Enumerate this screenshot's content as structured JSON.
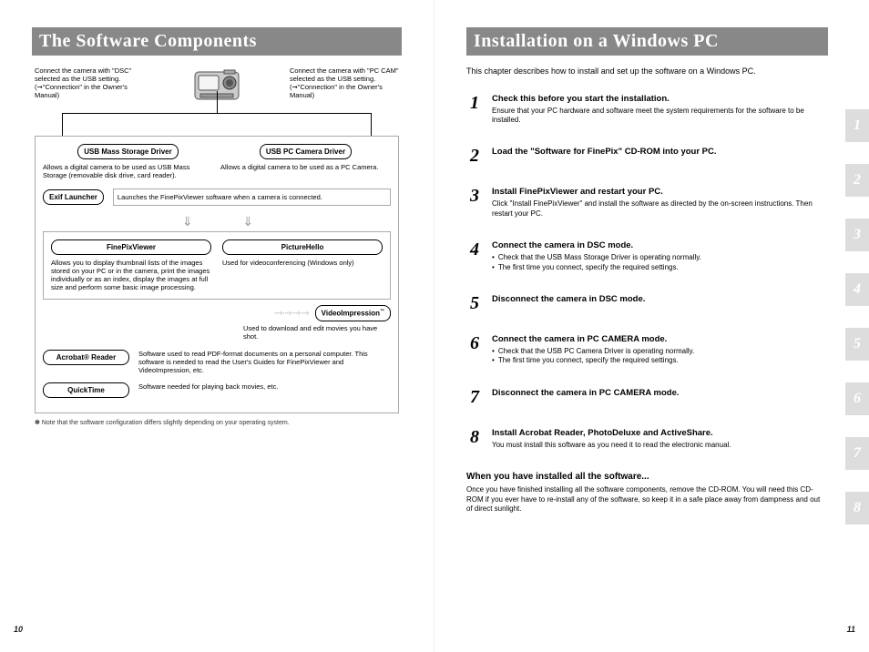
{
  "left": {
    "title": "The Software Components",
    "captions": {
      "dsc": "Connect the camera with \"DSC\" selected as the USB setting. (➞\"Connection\" in the Owner's Manual)",
      "pccam": "Connect the camera with \"PC CAM\" selected as the USB setting. (➞\"Connection\" in the Owner's Manual)"
    },
    "drivers": {
      "mass_label": "USB Mass Storage Driver",
      "mass_desc": "Allows a digital camera to be used as USB Mass Storage (removable disk drive, card reader).",
      "cam_label": "USB PC Camera Driver",
      "cam_desc": "Allows a digital camera to be used as a PC Camera."
    },
    "exif": {
      "label": "Exif Launcher",
      "desc": "Launches the FinePixViewer software when a camera is connected."
    },
    "fpv": {
      "label": "FinePixViewer",
      "desc": "Allows you to display thumbnail lists of the images stored on your PC or in the camera, print the images individually or as an index, display the images at full size and perform some basic image processing."
    },
    "ph": {
      "label": "PictureHello",
      "desc": "Used for videoconferencing (Windows only)"
    },
    "vi": {
      "label": "VideoImpression",
      "desc": "Used to download and edit movies you have shot."
    },
    "acrobat": {
      "label": "Acrobat® Reader",
      "desc": "Software used to read PDF-format documents on a personal computer. This software is needed to read the User's Guides for FinePixViewer and VideoImpression, etc."
    },
    "qt": {
      "label": "QuickTime",
      "desc": "Software needed for playing back movies, etc."
    },
    "footnote": "✽ Note that the software configuration differs slightly depending on your operating system.",
    "page_num": "10"
  },
  "right": {
    "title": "Installation on a Windows PC",
    "intro": "This chapter describes how to install and set up the software on a Windows PC.",
    "steps": [
      {
        "num": "1",
        "title": "Check this before you start the installation.",
        "desc": "Ensure that your PC hardware and software meet the system requirements for the software to be installed."
      },
      {
        "num": "2",
        "title": "Load the \"Software for FinePix\" CD-ROM into your PC.",
        "desc": ""
      },
      {
        "num": "3",
        "title": "Install FinePixViewer and restart your PC.",
        "desc": "Click \"Install FinePixViewer\" and install the software as directed by the on-screen instructions. Then restart your PC."
      },
      {
        "num": "4",
        "title": "Connect the camera in DSC mode.",
        "bullets": [
          "Check that the USB Mass Storage Driver is operating normally.",
          "The first time you connect, specify the required settings."
        ]
      },
      {
        "num": "5",
        "title": "Disconnect the camera in DSC mode.",
        "desc": ""
      },
      {
        "num": "6",
        "title": "Connect the camera in PC CAMERA mode.",
        "bullets": [
          "Check that the USB PC Camera Driver is operating normally.",
          "The first time you connect, specify the required settings."
        ]
      },
      {
        "num": "7",
        "title": "Disconnect the camera in PC CAMERA mode.",
        "desc": ""
      },
      {
        "num": "8",
        "title": "Install Acrobat Reader, PhotoDeluxe and ActiveShare.",
        "desc": "You must install this software as you need it to read the electronic manual."
      }
    ],
    "post_title": "When you have installed all the software...",
    "post_desc": "Once you have finished installing all the software components, remove the CD-ROM. You will need this CD-ROM if you ever have to re-install any of the software, so keep it in a safe place away from dampness and out of direct sunlight.",
    "side_tabs": [
      "1",
      "2",
      "3",
      "4",
      "5",
      "6",
      "7",
      "8"
    ],
    "page_num": "11"
  }
}
